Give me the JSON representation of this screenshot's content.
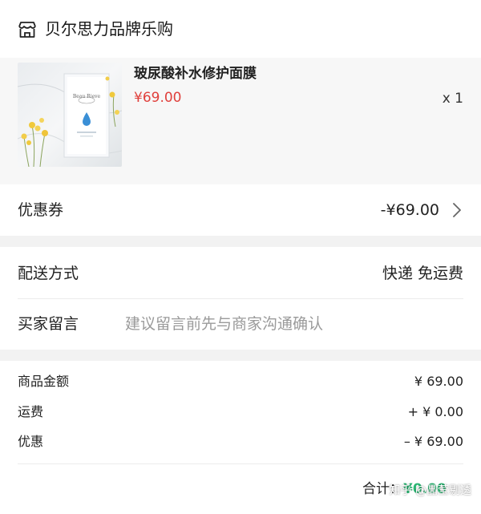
{
  "shop": {
    "name": "贝尔思力品牌乐购",
    "icon": "store-icon"
  },
  "product": {
    "title": "玻尿酸补水修护面膜",
    "price": "¥69.00",
    "quantity": "x 1",
    "image_brand_text": "Beau Rieve"
  },
  "coupon": {
    "label": "优惠券",
    "value": "-¥69.00",
    "icon": "chevron-right-icon"
  },
  "delivery": {
    "label": "配送方式",
    "value": "快递 免运费"
  },
  "remark": {
    "label": "买家留言",
    "placeholder": "建议留言前先与商家沟通确认"
  },
  "summary": {
    "subtotal_label": "商品金额",
    "subtotal_value": "¥ 69.00",
    "shipping_label": "运费",
    "shipping_value": "+ ¥ 0.00",
    "discount_label": "优惠",
    "discount_value": "– ¥ 69.00",
    "total_label": "合计：",
    "total_value": "¥0.00"
  },
  "watermark": "知乎 @晶莹剔透",
  "colors": {
    "price_red": "#e0403c",
    "total_green": "#2bb673",
    "background": "#f2f2f2"
  }
}
